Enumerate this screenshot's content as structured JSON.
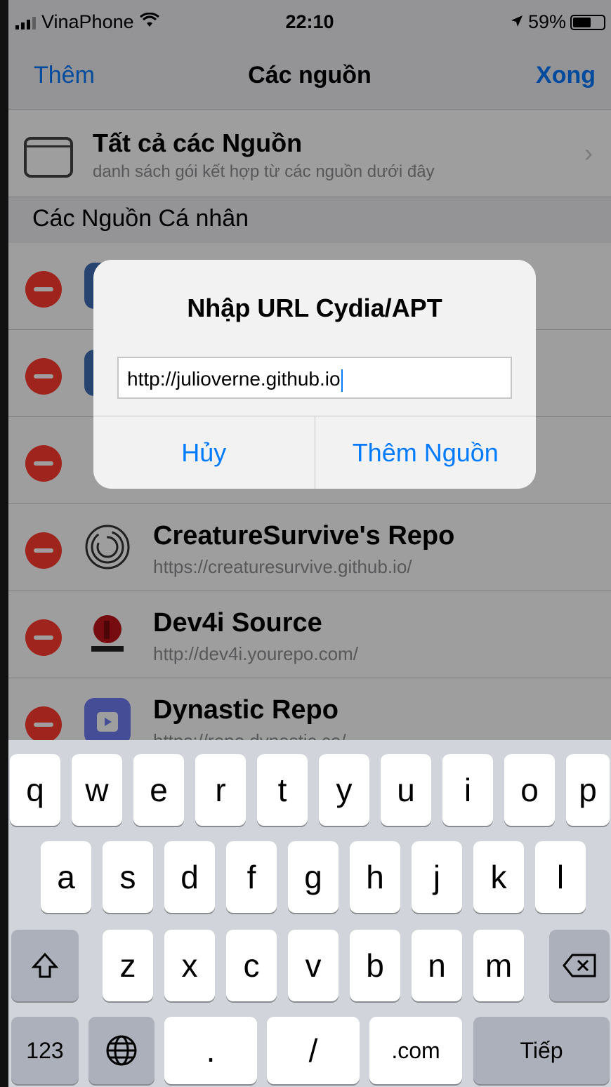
{
  "status_bar": {
    "carrier": "VinaPhone",
    "time": "22:10",
    "battery": "59%",
    "battery_level": 0.59
  },
  "nav": {
    "left": "Thêm",
    "title": "Các nguồn",
    "right": "Xong"
  },
  "all_sources": {
    "title": "Tất cả các Nguồn",
    "subtitle": "danh sách gói kết hợp từ các nguồn dưới đây"
  },
  "section_header": "Các Nguồn Cá nhân",
  "sources": [
    {
      "name": "",
      "url": "",
      "icon_color": "#3f6fb5"
    },
    {
      "name": "",
      "url": "",
      "icon_color": "#3f6fb5"
    },
    {
      "name": "",
      "url": "",
      "icon_color": "#ffffff"
    },
    {
      "name": "CreatureSurvive's Repo",
      "url": "https://creaturesurvive.github.io/",
      "icon_color": "#ffffff"
    },
    {
      "name": "Dev4i Source",
      "url": "http://dev4i.yourepo.com/",
      "icon_color": "#c0141a"
    },
    {
      "name": "Dynastic Repo",
      "url": "https://repo.dynastic.co/",
      "icon_color": "#6f7df0"
    }
  ],
  "alert": {
    "title": "Nhập URL Cydia/APT",
    "field_value": "http://julioverne.github.io",
    "cancel": "Hủy",
    "confirm": "Thêm Nguồn"
  },
  "keyboard": {
    "row1": [
      "q",
      "w",
      "e",
      "r",
      "t",
      "y",
      "u",
      "i",
      "o",
      "p"
    ],
    "row2": [
      "a",
      "s",
      "d",
      "f",
      "g",
      "h",
      "j",
      "k",
      "l"
    ],
    "row3": [
      "z",
      "x",
      "c",
      "v",
      "b",
      "n",
      "m"
    ],
    "numbers_key": "123",
    "dot_key": ".",
    "slash_key": "/",
    "dotcom_key": ".com",
    "return_key": "Tiếp"
  }
}
